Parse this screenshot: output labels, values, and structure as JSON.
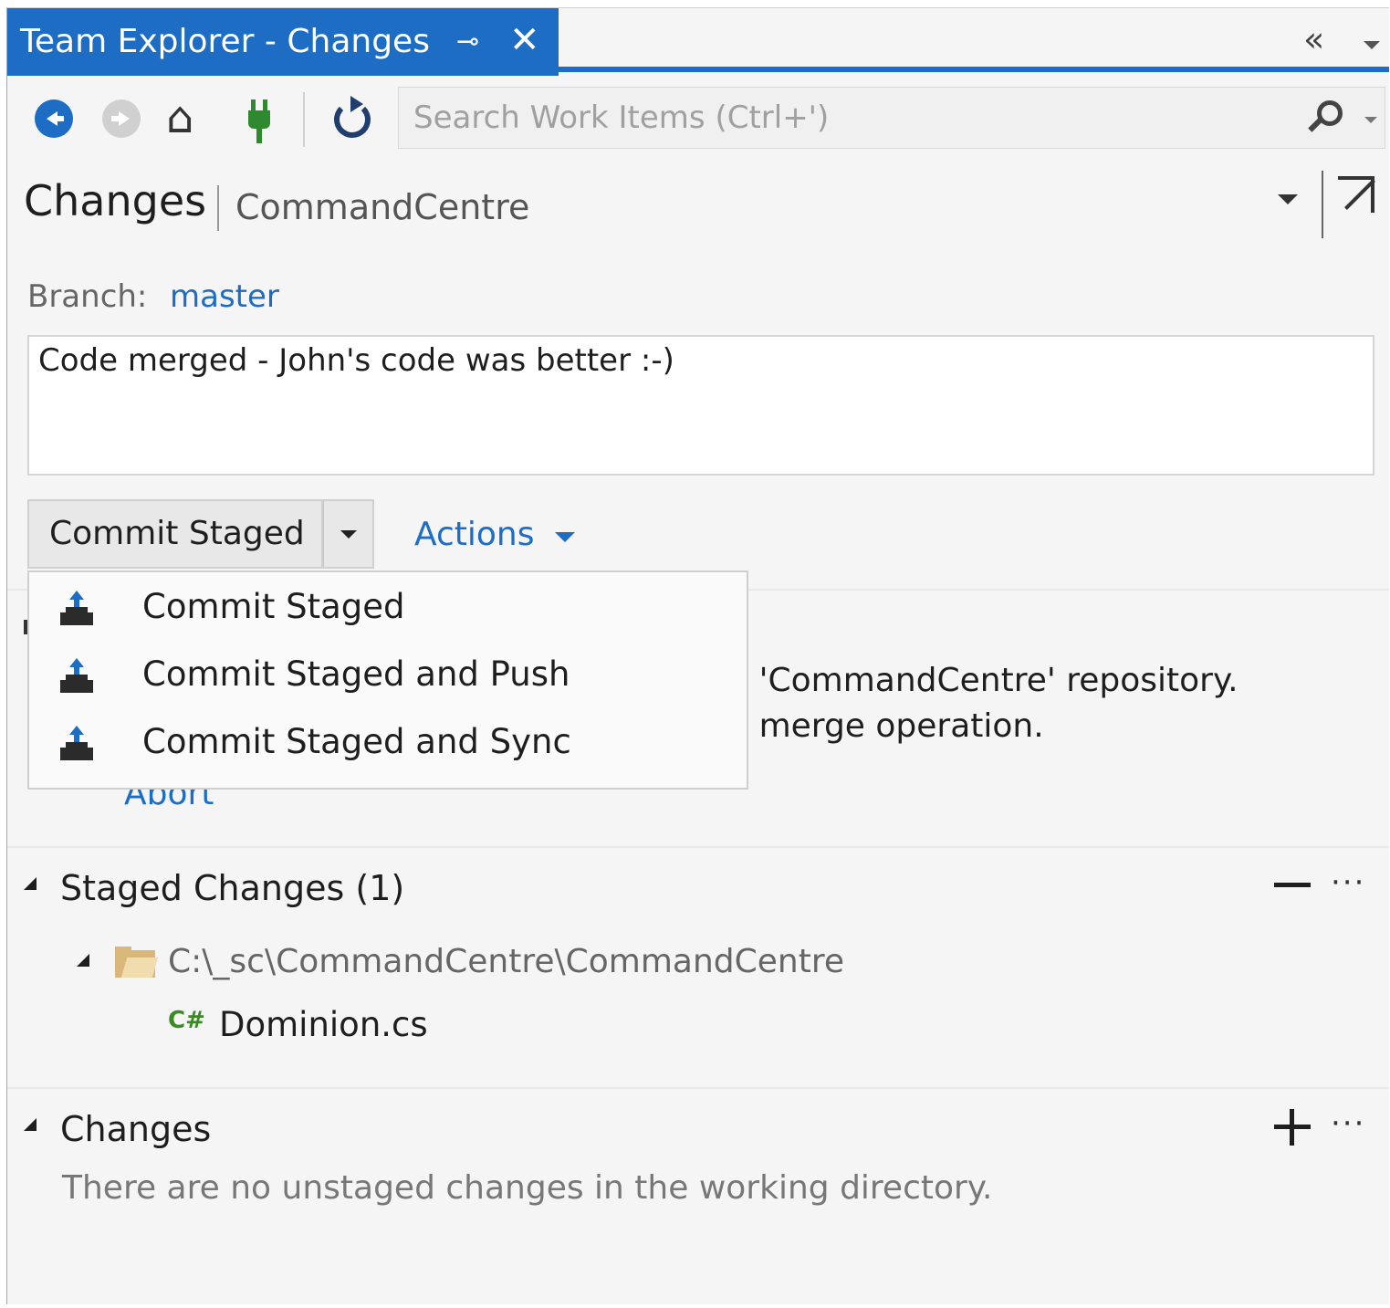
{
  "window": {
    "tab_title": "Team Explorer - Changes",
    "pin_glyph": "⊸",
    "close_glyph": "✕",
    "collapse_glyph": "«"
  },
  "toolbar": {
    "icons": [
      "back-icon",
      "forward-icon",
      "home-icon",
      "connect-icon",
      "refresh-icon",
      "search-icon"
    ],
    "search_placeholder": "Search Work Items (Ctrl+')",
    "search_value": ""
  },
  "header": {
    "title": "Changes",
    "subtitle": "CommandCentre"
  },
  "branch": {
    "label": "Branch:",
    "name": "master"
  },
  "commit": {
    "message": "Code merged - John's code was better :-)",
    "button_label": "Commit Staged",
    "actions_label": "Actions"
  },
  "menu": {
    "items": [
      {
        "label": "Commit Staged",
        "icon": "commit-icon"
      },
      {
        "label": "Commit Staged and Push",
        "icon": "commit-push-icon"
      },
      {
        "label": "Commit Staged and Sync",
        "icon": "commit-sync-icon"
      }
    ]
  },
  "merge_notice": {
    "line1": ": 'CommandCentre' repository.",
    "line2": ": merge operation.",
    "abort": "Abort"
  },
  "staged": {
    "title": "Staged Changes (1)",
    "more": "···",
    "folder_path": "C:\\_sc\\CommandCentre\\CommandCentre",
    "file_badge": "C#",
    "file_name": "Dominion.cs"
  },
  "changes": {
    "title": "Changes",
    "more": "···",
    "empty_message": "There are no unstaged changes in the working directory."
  },
  "colors": {
    "accent": "#1c6dc3",
    "panel_bg": "#f5f5f5",
    "csharp_green": "#3a8a25"
  }
}
